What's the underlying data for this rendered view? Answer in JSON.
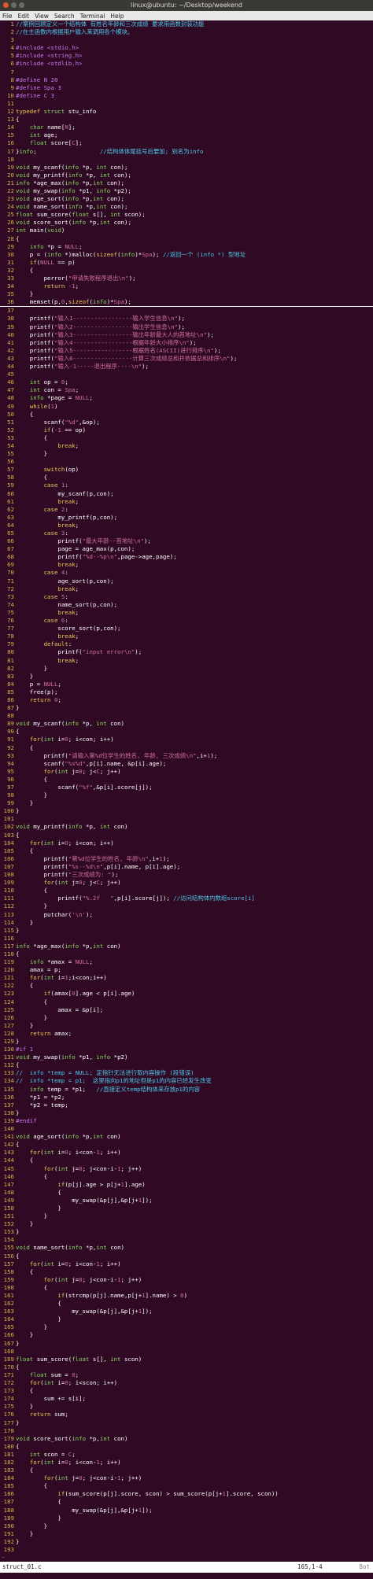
{
  "window": {
    "title": "linux@ubuntu: ~/Desktop/weekend"
  },
  "menu": [
    "File",
    "Edit",
    "View",
    "Search",
    "Terminal",
    "Help"
  ],
  "status": {
    "file": "struct_01.c",
    "position": "165,1-4",
    "scroll": "Bot"
  },
  "colors": {
    "background": "#300a24",
    "line_number": "#d9b04a",
    "comment": "#4ec8ec",
    "string": "#d36fa6",
    "keyword": "#e9c857",
    "type": "#87d860",
    "preproc": "#c97af0"
  },
  "cursor_line": 36,
  "lines": [
    "//案例回顾定义一个结构体 有姓名年龄和三次成绩 要求用函数封装功能",
    "//在主函数内根据用户输入来调用各个模块。",
    "",
    "#include <stdio.h>",
    "#include <string.h>",
    "#include <stdlib.h>",
    "",
    "#define N 20",
    "#define Spa 3",
    "#define C 3",
    "",
    "typedef struct stu_info",
    "{",
    "    char name[N];",
    "    int age;",
    "    float score[C];",
    "}info;                  //结构体体尾括号后要加; 别名为info",
    "",
    "void my_scanf(info *p, int con);",
    "void my_printf(info *p, int con);",
    "info *age_max(info *p,int con);",
    "void my_swap(info *p1, info *p2);",
    "void age_sort(info *p,int con);",
    "void name_sort(info *p,int con);",
    "float sum_score(float s[], int scon);",
    "void score_sort(info *p,int con);",
    "int main(void)",
    "{",
    "    info *p = NULL;",
    "    p = (info *)malloc(sizeof(info)*Spa); //返回一个 (info *) 型地址",
    "    if(NULL == p)",
    "    {",
    "        perror(\"申请失败程序退出\\n\");",
    "        return -1;",
    "    }",
    "    memset(p,0,sizeof(info)*Spa);",
    "",
    "    printf(\"输入1-----------------输入学生信息\\n\");",
    "    printf(\"输入2-----------------输出学生信息\\n\");",
    "    printf(\"输入3-----------------输出年龄最大人的首地址\\n\");",
    "    printf(\"输入4-----------------根据年龄大小排序\\n\");",
    "    printf(\"输入5-----------------根据姓名(ASCII)进行排序\\n\");",
    "    printf(\"输入6-----------------计算三次成绩总和并依据总和排序\\n\");",
    "    printf(\"输入-1-----退出程序----\\n\");",
    "",
    "    int op = 0;",
    "    int con = Spa;",
    "    info *page = NULL;",
    "    while(1)",
    "    {",
    "        scanf(\"%d\",&op);",
    "        if(-1 == op)",
    "        {",
    "            break;",
    "        }",
    "",
    "        switch(op)",
    "        {",
    "        case 1:",
    "            my_scanf(p,con);",
    "            break;",
    "        case 2:",
    "            my_printf(p,con);",
    "            break;",
    "        case 3:",
    "            printf(\"最大年龄--首地址\\n\");",
    "            page = age_max(p,con);",
    "            printf(\"%d--%p\\n\",page->age,page);",
    "            break;",
    "        case 4:",
    "            age_sort(p,con);",
    "            break;",
    "        case 5:",
    "            name_sort(p,con);",
    "            break;",
    "        case 6:",
    "            score_sort(p,con);",
    "            break;",
    "        default:",
    "            printf(\"input error\\n\");",
    "            break;",
    "        }",
    "    }",
    "    p = NULL;",
    "    free(p);",
    "    return 0;",
    "}",
    "",
    "void my_scanf(info *p, int con)",
    "{",
    "    for(int i=0; i<con; i++)",
    "    {",
    "        printf(\"请输入第%d位学生的姓名, 年龄, 三次成绩\\n\",i+1);",
    "        scanf(\"%s%d\",p[i].name, &p[i].age);",
    "        for(int j=0; j<C; j++)",
    "        {",
    "            scanf(\"%f\",&p[i].score[j]);",
    "        }",
    "    }",
    "}",
    "",
    "void my_printf(info *p, int con)",
    "{",
    "    for(int i=0; i<con; i++)",
    "    {",
    "        printf(\"第%d位学生的姓名, 年龄\\n\",i+1);",
    "        printf(\"%s--%d\\n\",p[i].name, p[i].age);",
    "        printf(\"三次成绩为: \");",
    "        for(int j=0; j<C; j++)",
    "        {",
    "            printf(\"%.2f   \",p[i].score[j]); //访问结构体内数组score[i]",
    "        }",
    "        putchar('\\n');",
    "    }",
    "}",
    "",
    "info *age_max(info *p,int con)",
    "{",
    "    info *amax = NULL;",
    "    amax = p;",
    "    for(int i=1;i<con;i++)",
    "    {",
    "        if(amax[0].age < p[i].age)",
    "        {",
    "            amax = &p[i];",
    "        }",
    "    }",
    "    return amax;",
    "}",
    "#if 1",
    "void my_swap(info *p1, info *p2)",
    "{",
    "//  info *temp = NULL; 定指针无法进行取内容操作 (段错误)",
    "//  info *temp = p1;  这里指向p1的地址但是p1的内容已经发生改变",
    "    info temp = *p1;   //直接定义temp结构体来存放p1的内容",
    "    *p1 = *p2;",
    "    *p2 = temp;",
    "}",
    "#endif",
    "",
    "void age_sort(info *p,int con)",
    "{",
    "    for(int i=0; i<con-1; i++)",
    "    {",
    "        for(int j=0; j<con-i-1; j++)",
    "        {",
    "            if(p[j].age > p[j+1].age)",
    "            {",
    "                my_swap(&p[j],&p[j+1]);",
    "            }",
    "        }",
    "    }",
    "}",
    "",
    "void name_sort(info *p,int con)",
    "{",
    "    for(int i=0; i<con-1; i++)",
    "    {",
    "        for(int j=0; j<con-i-1; j++)",
    "        {",
    "            if(strcmp(p[j].name,p[j+1].name) > 0)",
    "            {",
    "                my_swap(&p[j],&p[j+1]);",
    "            }",
    "        }",
    "    }",
    "}",
    "",
    "float sum_score(float s[], int scon)",
    "{",
    "    float sum = 0;",
    "    for(int i=0; i<scon; i++)",
    "    {",
    "        sum += s[i];",
    "    }",
    "    return sum;",
    "}",
    "",
    "void score_sort(info *p,int con)",
    "{",
    "    int scon = C;",
    "    for(int i=0; i<con-1; i++)",
    "    {",
    "        for(int j=0; j<con-i-1; j++)",
    "        {",
    "            if(sum_score(p[j].score, scon) > sum_score(p[j+1].score, scon))",
    "            {",
    "                my_swap(&p[j],&p[j+1]);",
    "            }",
    "        }",
    "    }",
    "}",
    ""
  ],
  "tilde_lines": 7
}
